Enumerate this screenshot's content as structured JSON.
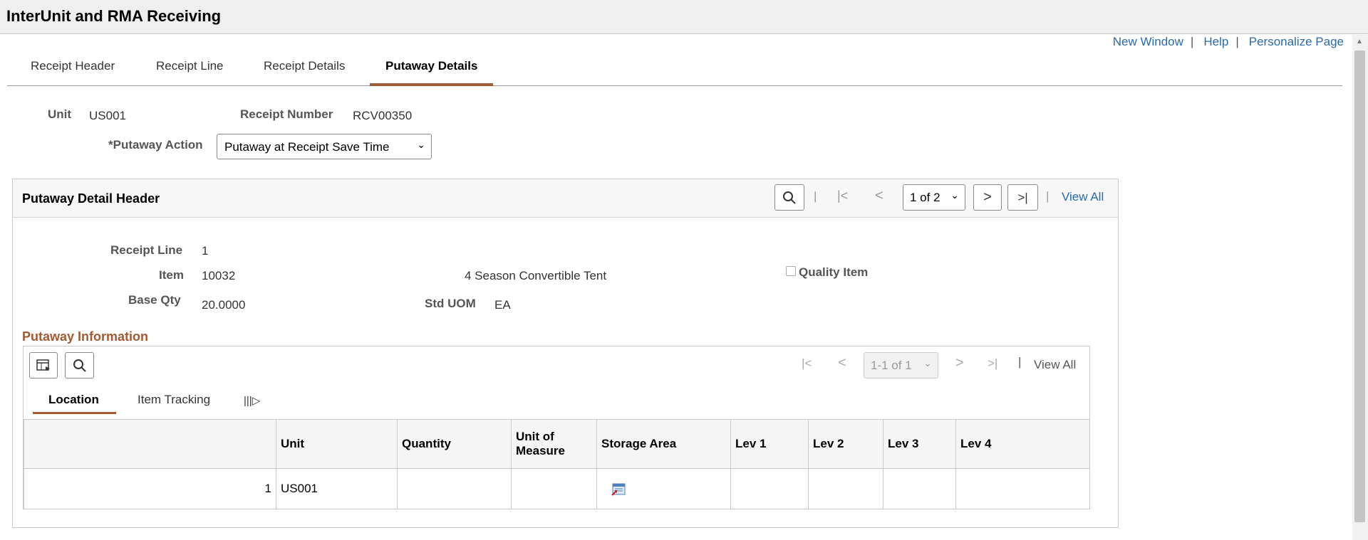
{
  "page": {
    "title": "InterUnit and RMA Receiving"
  },
  "links": {
    "new_window": "New Window",
    "help": "Help",
    "personalize": "Personalize Page",
    "sep": "|"
  },
  "tabs": [
    {
      "label": "Receipt Header"
    },
    {
      "label": "Receipt Line"
    },
    {
      "label": "Receipt Details"
    },
    {
      "label": "Putaway Details",
      "active": true
    }
  ],
  "header": {
    "unit_label": "Unit",
    "unit_value": "US001",
    "receipt_number_label": "Receipt Number",
    "receipt_number_value": "RCV00350",
    "putaway_action_label": "*Putaway Action",
    "putaway_action_value": "Putaway at Receipt Save Time"
  },
  "detail_panel": {
    "title": "Putaway Detail Header",
    "pager": "1 of 2",
    "view_all": "View All",
    "receipt_line_label": "Receipt Line",
    "receipt_line_value": "1",
    "item_label": "Item",
    "item_value": "10032",
    "item_description": "4 Season Convertible Tent",
    "quality_item_label": "Quality Item",
    "quality_item_checked": false,
    "base_qty_label": "Base Qty",
    "base_qty_value": "20.0000",
    "std_uom_label": "Std UOM",
    "std_uom_value": "EA"
  },
  "putaway_info": {
    "title": "Putaway Information",
    "pager": "1-1 of 1",
    "view_all": "View All",
    "subtabs": [
      {
        "label": "Location",
        "active": true
      },
      {
        "label": "Item Tracking"
      }
    ],
    "columns": [
      "",
      "Unit",
      "Quantity",
      "Unit of Measure",
      "Storage Area",
      "Lev 1",
      "Lev 2",
      "Lev 3",
      "Lev 4"
    ],
    "rows": [
      {
        "row_num": "1",
        "unit": "US001",
        "quantity": "",
        "uom": "",
        "storage_area": "",
        "lev1": "",
        "lev2": "",
        "lev3": "",
        "lev4": ""
      }
    ]
  },
  "colors": {
    "accent": "#a25a32",
    "link": "#2a6aa8"
  }
}
